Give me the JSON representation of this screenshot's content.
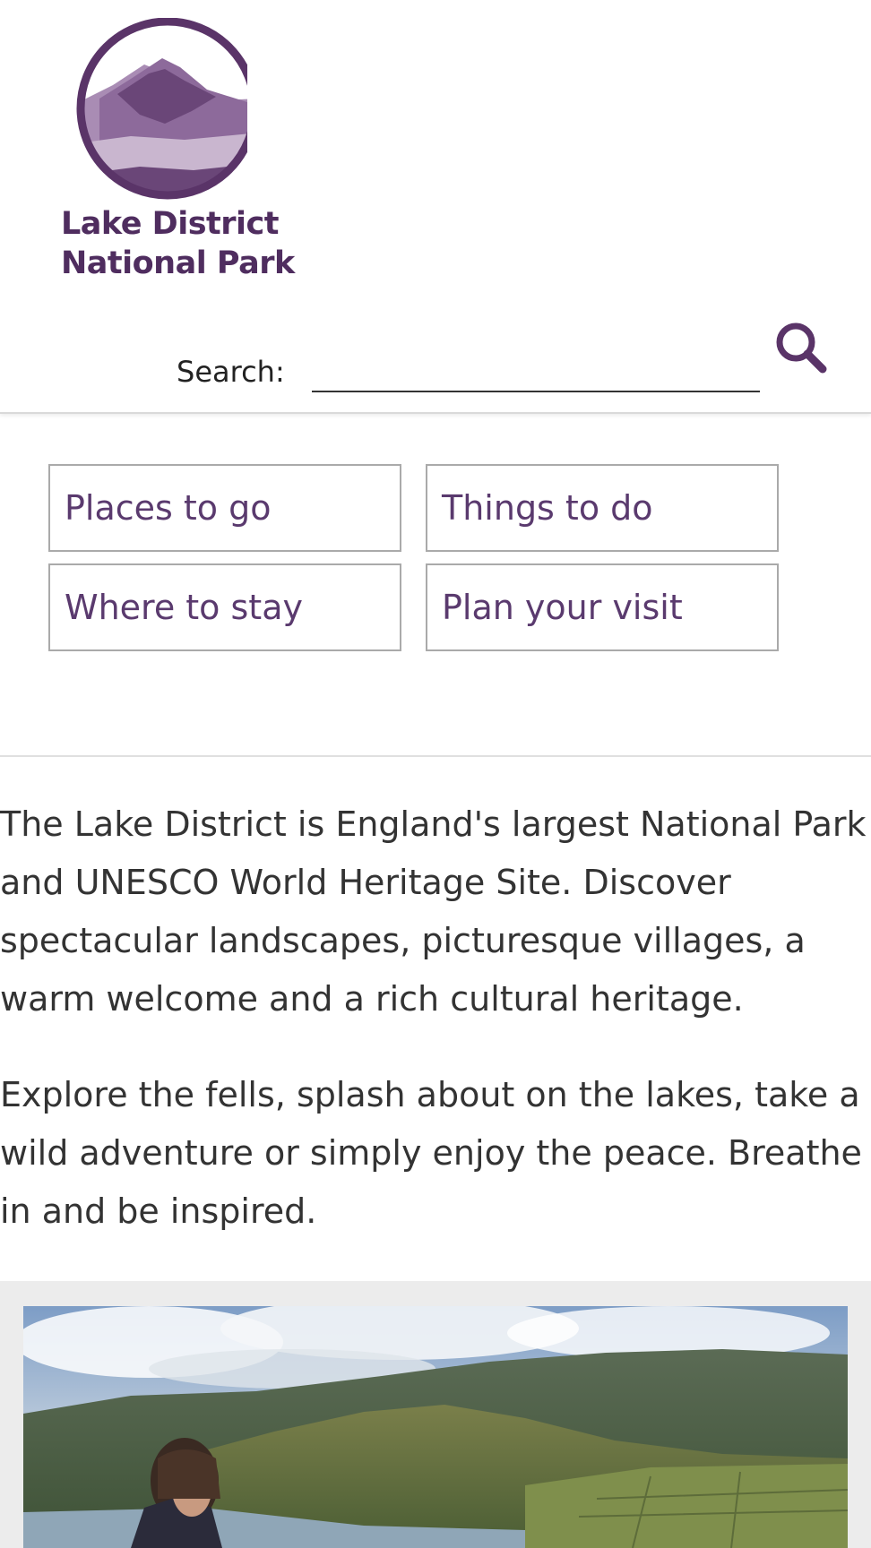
{
  "header": {
    "logo": {
      "line1": "Lake District",
      "line2": "National Park",
      "color": "#4f2d5f"
    },
    "search": {
      "label": "Search:",
      "value": "",
      "icon": "search-icon"
    }
  },
  "nav": {
    "items": [
      {
        "label": "Places to go"
      },
      {
        "label": "Things to do"
      },
      {
        "label": "Where to stay"
      },
      {
        "label": "Plan your visit"
      }
    ],
    "text_color": "#5a3a6e"
  },
  "intro": {
    "paragraphs": [
      "The Lake District is England's largest National Park and UNESCO World Heritage Site. Discover spectacular landscapes, picturesque villages, a warm welcome and a rich cultural heritage.",
      "Explore the fells, splash about on the lakes, take a wild adventure or simply enjoy the peace. Breathe in and be inspired."
    ]
  },
  "hero": {
    "image": "landscape-photo"
  }
}
